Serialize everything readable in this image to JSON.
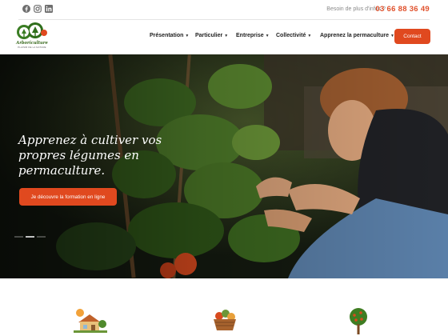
{
  "topbar": {
    "social": [
      {
        "name": "facebook-icon"
      },
      {
        "name": "instagram-icon"
      },
      {
        "name": "linkedin-icon"
      }
    ],
    "info_label": "Besoin de plus d'infos ?",
    "phone": "03 66 88 36 49"
  },
  "brand": {
    "name": "Arboriculture",
    "tagline": "PLAISIR DE LA NATURE"
  },
  "nav": {
    "items": [
      {
        "label": "Présentation"
      },
      {
        "label": "Particulier"
      },
      {
        "label": "Entreprise"
      },
      {
        "label": "Collectivité"
      },
      {
        "label": "Apprenez la permaculture"
      }
    ],
    "contact_label": "Contact"
  },
  "hero": {
    "title_lines": [
      "Apprenez à cultiver vos",
      "propres légumes en",
      "permaculture."
    ],
    "button_label": "Je découvre la formation en ligne",
    "slides": 3,
    "active_slide": 1
  },
  "features": [
    {
      "icon": "garden-house-icon"
    },
    {
      "icon": "vegetable-basket-icon"
    },
    {
      "icon": "fruit-tree-icon"
    }
  ],
  "colors": {
    "accent": "#e0491f",
    "phone": "#e0512c",
    "brand_green": "#3a6b1f"
  }
}
